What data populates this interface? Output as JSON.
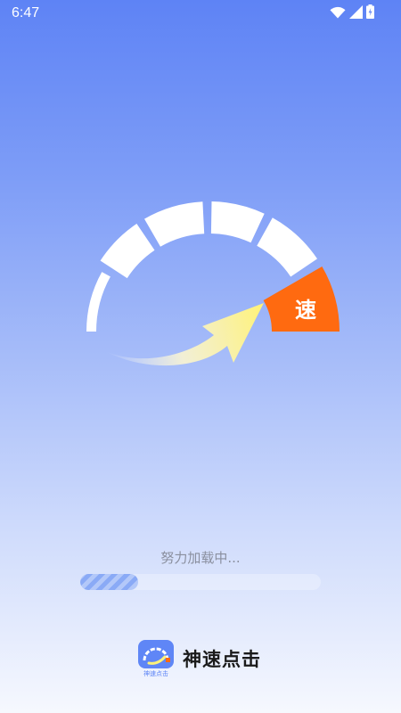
{
  "status_bar": {
    "time": "6:47",
    "icons": [
      "wifi-icon",
      "signal-icon",
      "battery-icon"
    ]
  },
  "splash": {
    "gauge_badge": "速",
    "loading_text": "努力加载中...",
    "progress_fraction": 0.24
  },
  "app": {
    "name": "神速点击",
    "logo_caption": "神速点击"
  },
  "colors": {
    "accent_orange": "#ff6a10",
    "progress_fill": "#8aaaf6",
    "arrow_yellow": "#fff27a",
    "background_top": "#5e83f5",
    "background_bottom": "#f6f8fe"
  }
}
